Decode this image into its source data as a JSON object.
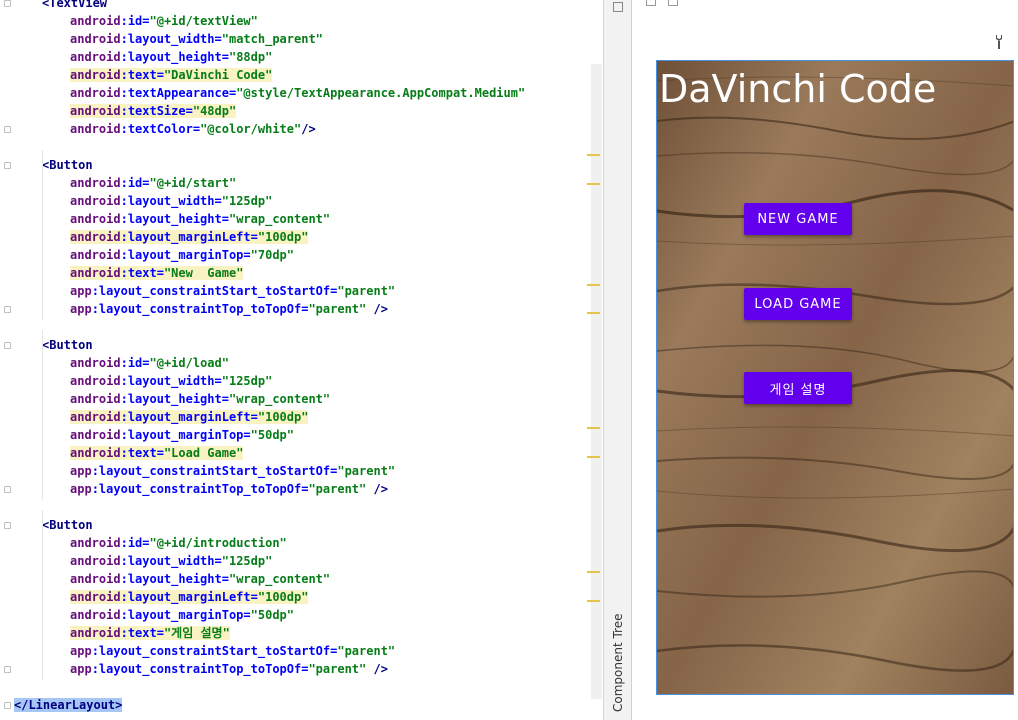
{
  "editor": {
    "lines": [
      {
        "tag": "<TextView"
      },
      {
        "ns": "android",
        "attr": "id",
        "value": "\"@+id/textView\""
      },
      {
        "ns": "android",
        "attr": "layout_width",
        "value": "\"match_parent\""
      },
      {
        "ns": "android",
        "attr": "layout_height",
        "value": "\"88dp\""
      },
      {
        "ns": "android",
        "attr": "text",
        "value": "\"DaVinchi Code\""
      },
      {
        "ns": "android",
        "attr": "textAppearance",
        "value": "\"@style/TextAppearance.AppCompat.Medium\""
      },
      {
        "ns": "android",
        "attr": "textSize",
        "value": "\"48dp\""
      },
      {
        "ns": "android",
        "attr": "textColor",
        "value": "\"@color/white\"",
        "tail": "/>"
      },
      {
        "tag": "<Button"
      },
      {
        "ns": "android",
        "attr": "id",
        "value": "\"@+id/start\""
      },
      {
        "ns": "android",
        "attr": "layout_width",
        "value": "\"125dp\""
      },
      {
        "ns": "android",
        "attr": "layout_height",
        "value": "\"wrap_content\""
      },
      {
        "ns": "android",
        "attr": "layout_marginLeft",
        "value": "\"100dp\""
      },
      {
        "ns": "android",
        "attr": "layout_marginTop",
        "value": "\"70dp\""
      },
      {
        "ns": "android",
        "attr": "text",
        "value": "\"New  Game\""
      },
      {
        "ns": "app",
        "attr": "layout_constraintStart_toStartOf",
        "value": "\"parent\""
      },
      {
        "ns": "app",
        "attr": "layout_constraintTop_toTopOf",
        "value": "\"parent\"",
        "tail": " />"
      },
      {
        "tag": "<Button"
      },
      {
        "ns": "android",
        "attr": "id",
        "value": "\"@+id/load\""
      },
      {
        "ns": "android",
        "attr": "layout_width",
        "value": "\"125dp\""
      },
      {
        "ns": "android",
        "attr": "layout_height",
        "value": "\"wrap_content\""
      },
      {
        "ns": "android",
        "attr": "layout_marginLeft",
        "value": "\"100dp\""
      },
      {
        "ns": "android",
        "attr": "layout_marginTop",
        "value": "\"50dp\""
      },
      {
        "ns": "android",
        "attr": "text",
        "value": "\"Load Game\""
      },
      {
        "ns": "app",
        "attr": "layout_constraintStart_toStartOf",
        "value": "\"parent\""
      },
      {
        "ns": "app",
        "attr": "layout_constraintTop_toTopOf",
        "value": "\"parent\"",
        "tail": " />"
      },
      {
        "tag": "<Button"
      },
      {
        "ns": "android",
        "attr": "id",
        "value": "\"@+id/introduction\""
      },
      {
        "ns": "android",
        "attr": "layout_width",
        "value": "\"125dp\""
      },
      {
        "ns": "android",
        "attr": "layout_height",
        "value": "\"wrap_content\""
      },
      {
        "ns": "android",
        "attr": "layout_marginLeft",
        "value": "\"100dp\""
      },
      {
        "ns": "android",
        "attr": "layout_marginTop",
        "value": "\"50dp\""
      },
      {
        "ns": "android",
        "attr": "text",
        "value": "\"게임 설명\""
      },
      {
        "ns": "app",
        "attr": "layout_constraintStart_toStartOf",
        "value": "\"parent\""
      },
      {
        "ns": "app",
        "attr": "layout_constraintTop_toTopOf",
        "value": "\"parent\"",
        "tail": " />"
      },
      {
        "tag": "</LinearLayout>"
      }
    ]
  },
  "side_panel": {
    "label": "Component Tree"
  },
  "preview": {
    "title": "DaVinchi Code",
    "buttons": {
      "new_game": "NEW  GAME",
      "load_game": "LOAD GAME",
      "introduction": "게임 설명"
    },
    "button_color": "#6200ee"
  }
}
